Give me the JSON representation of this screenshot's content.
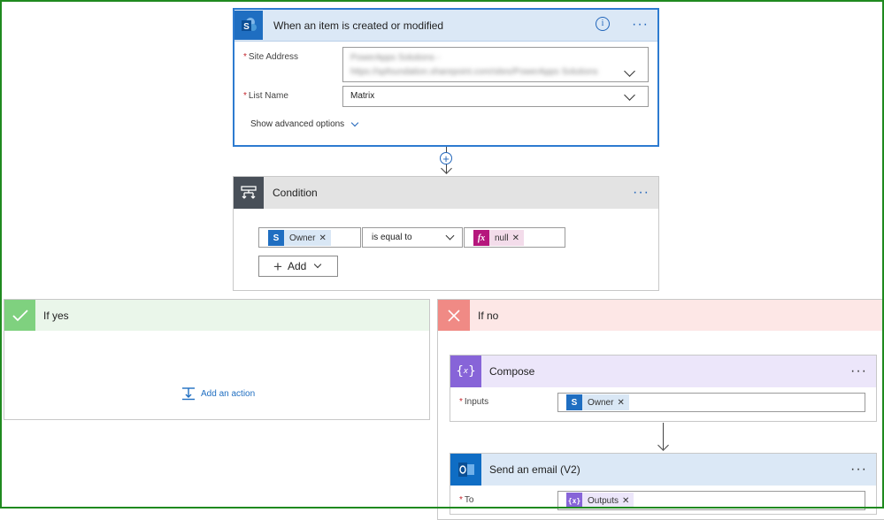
{
  "trigger": {
    "title": "When an item is created or modified",
    "site_address_label": "Site Address",
    "site_address_value": "PowerApps Solutions - https://spfoundation.sharepoint.com/sites/PowerApps Solutions",
    "list_name_label": "List Name",
    "list_name_value": "Matrix",
    "advanced_label": "Show advanced options"
  },
  "condition": {
    "title": "Condition",
    "left_token": "Owner",
    "operator": "is equal to",
    "right_token": "null",
    "add_label": "Add"
  },
  "if_yes": {
    "title": "If yes",
    "add_action_label": "Add an action"
  },
  "if_no": {
    "title": "If no",
    "compose": {
      "title": "Compose",
      "inputs_label": "Inputs",
      "token": "Owner"
    },
    "email": {
      "title": "Send an email (V2)",
      "to_label": "To",
      "token": "Outputs"
    }
  },
  "colors": {
    "sharepoint": "#1f6ec1",
    "condition": "#484f58",
    "yes_green": "#7fd17f",
    "no_red": "#f08a85",
    "compose_purple": "#8764d8",
    "outlook_blue": "#0f6dc4",
    "fx_pink": "#b5177c",
    "frame_green": "#1f8a1f"
  }
}
